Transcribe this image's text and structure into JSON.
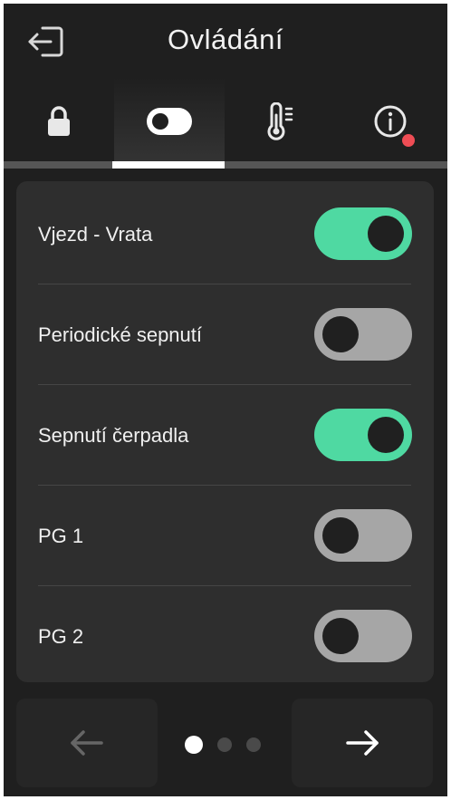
{
  "header": {
    "title": "Ovládání",
    "back_icon": "exit-icon"
  },
  "tabs": [
    {
      "icon": "lock-icon",
      "active": false
    },
    {
      "icon": "toggle-icon",
      "active": true
    },
    {
      "icon": "thermometer-icon",
      "active": false
    },
    {
      "icon": "info-icon",
      "active": false,
      "badge": true
    }
  ],
  "controls": [
    {
      "label": "Vjezd - Vrata",
      "state": "on"
    },
    {
      "label": "Periodické sepnutí",
      "state": "off"
    },
    {
      "label": "Sepnutí čerpadla",
      "state": "on"
    },
    {
      "label": "PG 1",
      "state": "off"
    },
    {
      "label": "PG 2",
      "state": "off"
    }
  ],
  "footer": {
    "prev_icon": "arrow-left-icon",
    "next_icon": "arrow-right-icon",
    "pages": 3,
    "current_page": 1
  },
  "colors": {
    "toggle_on": "#4fd9a2",
    "toggle_off": "#a6a6a6",
    "badge": "#ef4d55",
    "background": "#1f1f1f",
    "panel": "#2e2e2e"
  }
}
